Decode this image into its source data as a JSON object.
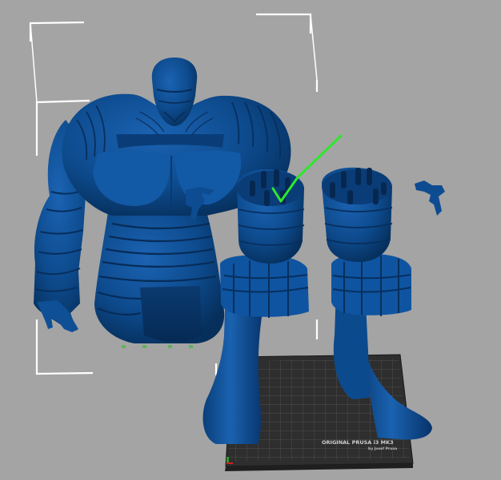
{
  "viewport": {
    "background": "#a4a4a4",
    "model_color": "#0d4a8c",
    "selection_color": "#ffffff",
    "check_color": "#2ee82e"
  },
  "bed": {
    "label": "ORIGINAL PRUSA i3 MK3",
    "sublabel": "by Josef Prusa",
    "surface_color": "#303030",
    "grid_color": "#5a5a5a"
  },
  "icons": [
    "checkmark-icon",
    "selection-box-icon"
  ]
}
